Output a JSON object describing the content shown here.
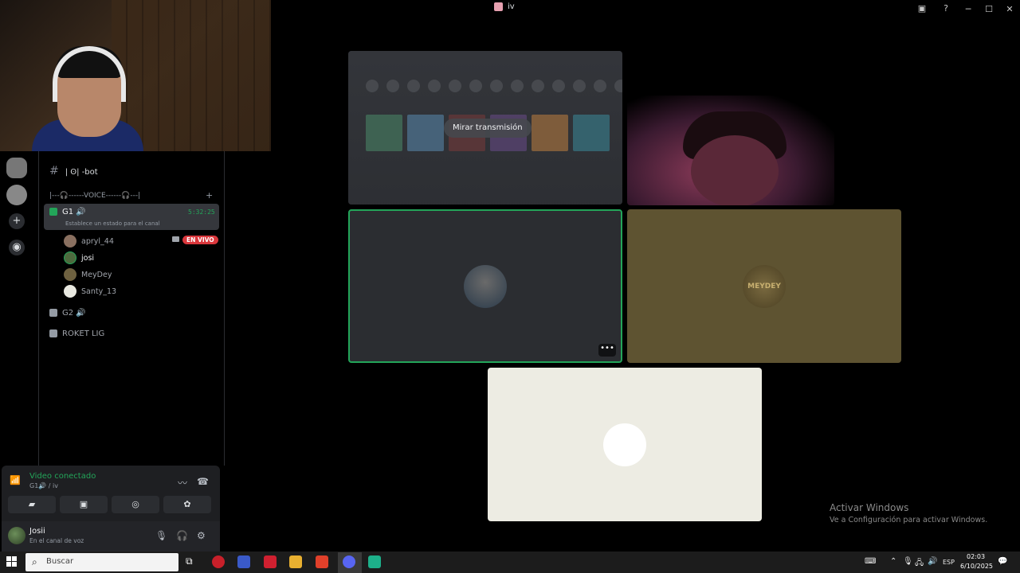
{
  "window": {
    "title": "iv"
  },
  "channels": {
    "text_partial": "| ʘ| -bot",
    "category": "|---🎧------VOICE------🎧---|",
    "voice_active": {
      "name": "G1",
      "timer": "5:32:25",
      "status_hint": "Establece un estado para el canal",
      "members": [
        {
          "name": "apryl_44",
          "live": "EN VIVO"
        },
        {
          "name": "josi"
        },
        {
          "name": "MeyDey"
        },
        {
          "name": "Santy_13"
        }
      ]
    },
    "voice_others": [
      "G2",
      "ROKET LIG"
    ]
  },
  "voice_panel": {
    "title": "Video conectado",
    "subtitle": "G1🔊 / iv",
    "buttons": [
      "camera-off",
      "screen-share",
      "activities",
      "soundboard"
    ]
  },
  "user_panel": {
    "name": "Josii",
    "status": "En el canal de voz"
  },
  "stream_tile": {
    "button": "Mirar transmisión"
  },
  "tiles": [
    "apryl_44-stream",
    "cam-2",
    "josi",
    "MeyDey",
    "Santy_13"
  ],
  "tile_labels": {
    "meydey_avatar_text": "MEYDEY"
  },
  "activate": {
    "line1": "Activar Windows",
    "line2": "Ve a Configuración para activar Windows."
  },
  "taskbar": {
    "search_placeholder": "Buscar",
    "lang": "ESP",
    "time": "02:03",
    "date": "6/10/2025"
  },
  "colors": {
    "accent_green": "#23a559",
    "live_red": "#da373c",
    "meydey_tile": "#5e5331",
    "santy_tile": "#edece3"
  }
}
